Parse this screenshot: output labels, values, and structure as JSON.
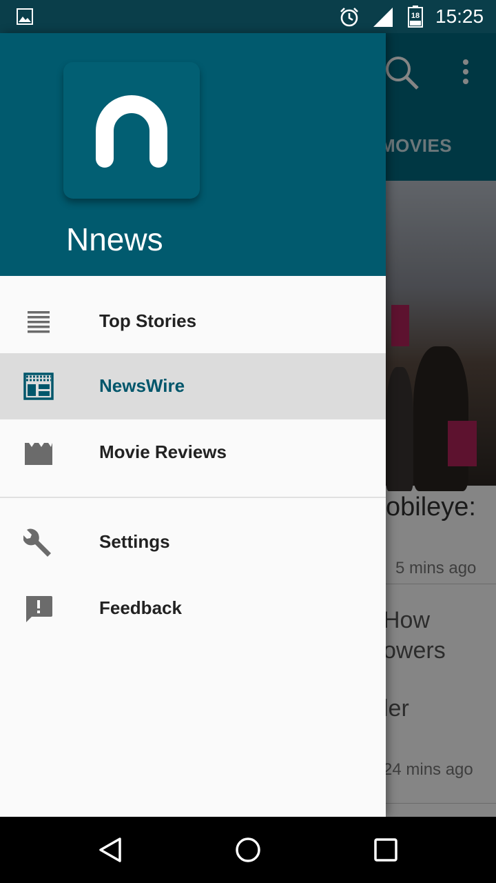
{
  "status_bar": {
    "time": "15:25",
    "battery_level": "18",
    "icons": [
      "image-icon",
      "alarm-icon",
      "signal-icon",
      "battery-icon"
    ]
  },
  "background": {
    "tab_label": "MOVIES",
    "headline_fragment_1": "obileye:",
    "time_ago_1": "5 mins ago",
    "headline_fragment_2a": "How",
    "headline_fragment_2b": "owers",
    "headline_fragment_2c": "ler",
    "time_ago_2": "24 mins ago"
  },
  "drawer": {
    "app_name": "Nnews",
    "items": [
      {
        "label": "Top Stories",
        "icon": "list-icon",
        "selected": false
      },
      {
        "label": "NewsWire",
        "icon": "newspaper-icon",
        "selected": true
      },
      {
        "label": "Movie Reviews",
        "icon": "movie-icon",
        "selected": false
      },
      {
        "label": "Settings",
        "icon": "wrench-icon",
        "selected": false
      },
      {
        "label": "Feedback",
        "icon": "feedback-icon",
        "selected": false
      }
    ]
  },
  "colors": {
    "primary": "#006a80",
    "primary_dark": "#0a3e4a",
    "drawer_header": "#015a6e",
    "selected_text": "#00566b",
    "selected_bg": "#dcdcdc"
  },
  "nav_bar": {
    "buttons": [
      "back-icon",
      "home-icon",
      "recents-icon"
    ]
  }
}
